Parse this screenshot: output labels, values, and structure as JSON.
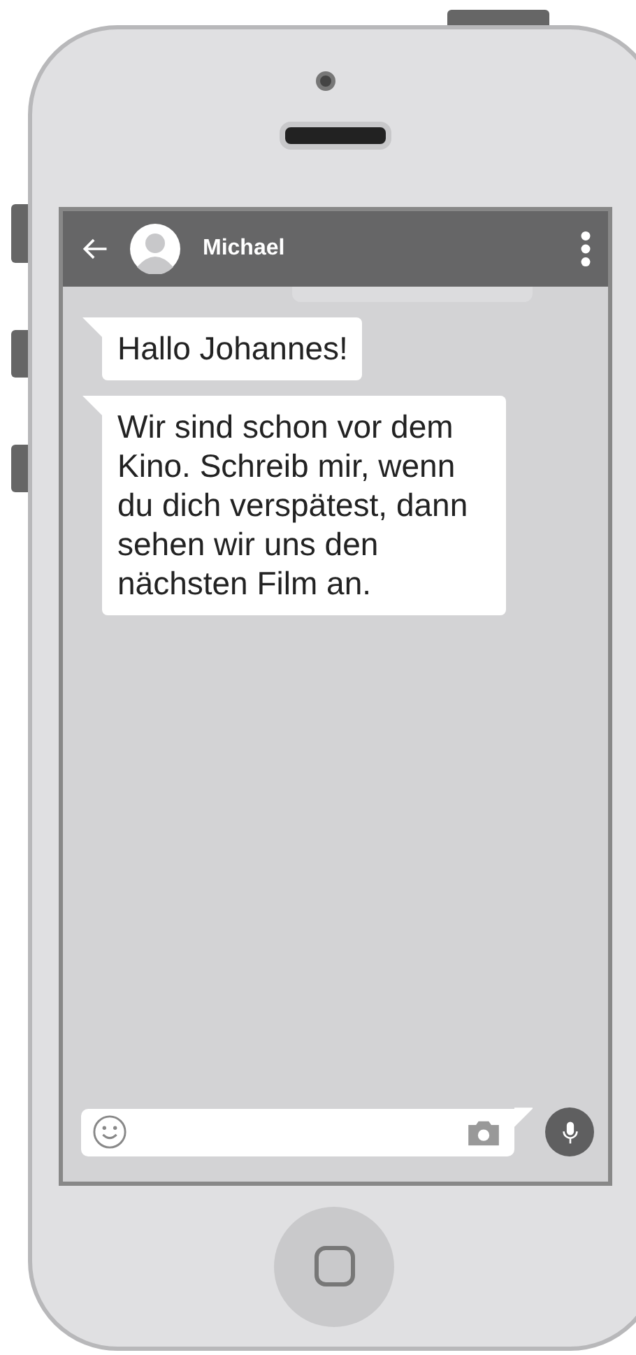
{
  "chat_header": {
    "contact_name": "Michael"
  },
  "messages": [
    {
      "text": "Hallo Johannes!"
    },
    {
      "text": "Wir sind schon vor dem Kino. Schreib mir, wenn du dich verspätest, dann sehen wir uns den nächsten Film an."
    }
  ]
}
